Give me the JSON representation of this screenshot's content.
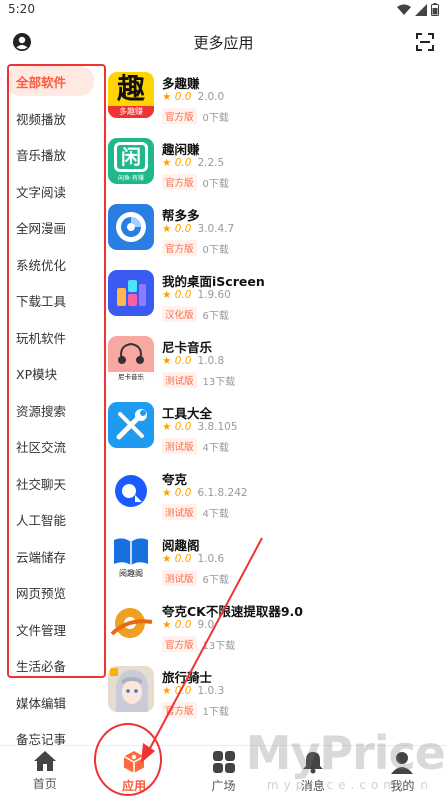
{
  "status": {
    "time": "5:20"
  },
  "appbar": {
    "title": "更多应用",
    "account_icon": "account-icon",
    "scan_icon": "scan-icon"
  },
  "sidebar": {
    "items": [
      {
        "label": "全部软件",
        "active": true
      },
      {
        "label": "视频播放"
      },
      {
        "label": "音乐播放"
      },
      {
        "label": "文字阅读"
      },
      {
        "label": "全网漫画"
      },
      {
        "label": "系统优化"
      },
      {
        "label": "下载工具"
      },
      {
        "label": "玩机软件"
      },
      {
        "label": "XP模块"
      },
      {
        "label": "资源搜索"
      },
      {
        "label": "社区交流"
      },
      {
        "label": "社交聊天"
      },
      {
        "label": "人工智能"
      },
      {
        "label": "云端储存"
      },
      {
        "label": "网页预览"
      },
      {
        "label": "文件管理"
      },
      {
        "label": "生活必备"
      },
      {
        "label": "媒体编辑"
      },
      {
        "label": "备忘记事"
      }
    ]
  },
  "apps": [
    {
      "name": "多趣赚",
      "rating": "★ 0.0",
      "version": "2.0.0",
      "badge": "官方版",
      "downloads": "0下载",
      "icon_text": "趣",
      "icon_sub": "多趣赚"
    },
    {
      "name": "趣闲赚",
      "rating": "★ 0.0",
      "version": "2.2.5",
      "badge": "官方版",
      "downloads": "0下载",
      "icon_text": "闲",
      "icon_sub": "闲鱼·有赚"
    },
    {
      "name": "帮多多",
      "rating": "★ 0.0",
      "version": "3.0.4.7",
      "badge": "官方版",
      "downloads": "0下载"
    },
    {
      "name": "我的桌面iScreen",
      "rating": "★ 0.0",
      "version": "1.9.60",
      "badge": "汉化版",
      "downloads": "6下载"
    },
    {
      "name": "尼卡音乐",
      "rating": "★ 0.0",
      "version": "1.0.8",
      "badge": "测试版",
      "downloads": "13下载",
      "icon_sub": "尼卡音乐"
    },
    {
      "name": "工具大全",
      "rating": "★ 0.0",
      "version": "3.8.105",
      "badge": "测试版",
      "downloads": "4下载"
    },
    {
      "name": "夸克",
      "rating": "★ 0.0",
      "version": "6.1.8.242",
      "badge": "测试版",
      "downloads": "4下载"
    },
    {
      "name": "阅趣阁",
      "rating": "★ 0.0",
      "version": "1.0.6",
      "badge": "测试版",
      "downloads": "6下载",
      "icon_sub": "阅趣阁"
    },
    {
      "name": "夸克CK不限速提取器9.0",
      "rating": "★ 0.0",
      "version": "9.0",
      "badge": "官方版",
      "downloads": "13下载"
    },
    {
      "name": "旅行骑士",
      "rating": "★ 0.0",
      "version": "1.0.3",
      "badge": "官方版",
      "downloads": "1下载"
    }
  ],
  "tabs": [
    {
      "label": "首页",
      "icon": "home-icon"
    },
    {
      "label": "应用",
      "icon": "apps-cube-icon",
      "active": true
    },
    {
      "label": "广场",
      "icon": "grid-icon"
    },
    {
      "label": "消息",
      "icon": "bell-icon"
    },
    {
      "label": "我的",
      "icon": "profile-icon"
    }
  ],
  "watermark": {
    "big": "MyPrice",
    "small": "myprice.com.cn"
  },
  "colors": {
    "accent": "#ff5a3c",
    "annotation": "#e33333",
    "badge_bg": "#fff1ec",
    "star": "#ffa000"
  }
}
